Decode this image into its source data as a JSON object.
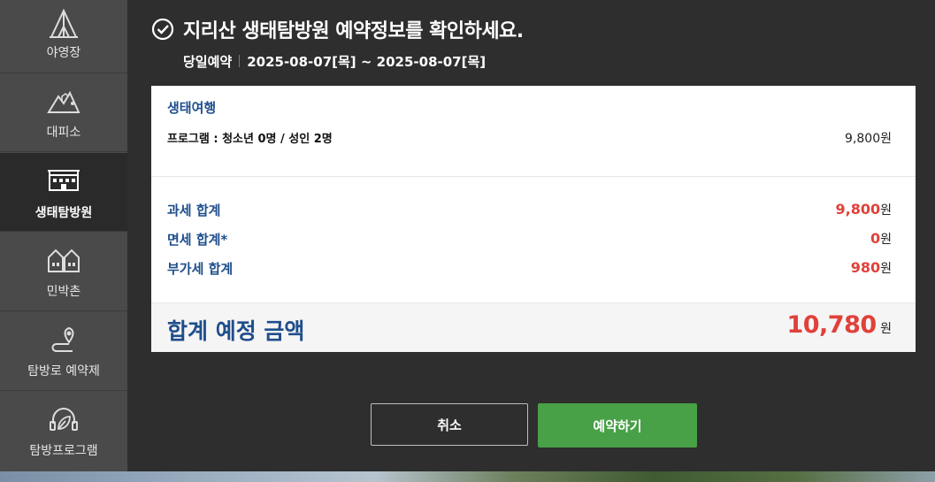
{
  "sidebar": {
    "items": [
      {
        "label": "야영장",
        "icon": "tent-icon"
      },
      {
        "label": "대피소",
        "icon": "mountain-shelter-icon"
      },
      {
        "label": "생태탐방원",
        "icon": "building-icon",
        "active": true
      },
      {
        "label": "민박촌",
        "icon": "houses-icon"
      },
      {
        "label": "탐방로 예약제",
        "icon": "trail-pin-icon"
      },
      {
        "label": "탐방프로그램",
        "icon": "leaf-headset-icon"
      }
    ]
  },
  "header": {
    "title": "지리산 생태탐방원 예약정보를 확인하세요.",
    "booking_type": "당일예약",
    "date_range": "2025-08-07[목] ~ 2025-08-07[목]"
  },
  "detail": {
    "section_title": "생태여행",
    "program_label": "프로그램 : 청소년 0명 / 성인 2명",
    "program_price": "9,800원"
  },
  "summary": {
    "taxable_label": "과세 합계",
    "taxable_value": "9,800",
    "tax_free_label": "면세 합계*",
    "tax_free_value": "0",
    "vat_label": "부가세 합계",
    "vat_value": "980",
    "currency": "원"
  },
  "total": {
    "label": "합계 예정 금액",
    "value": "10,780",
    "currency": "원"
  },
  "buttons": {
    "cancel": "취소",
    "reserve": "예약하기"
  },
  "colors": {
    "accent_blue": "#1f4e8c",
    "price_red": "#e0413a",
    "reserve_green": "#48a047"
  }
}
